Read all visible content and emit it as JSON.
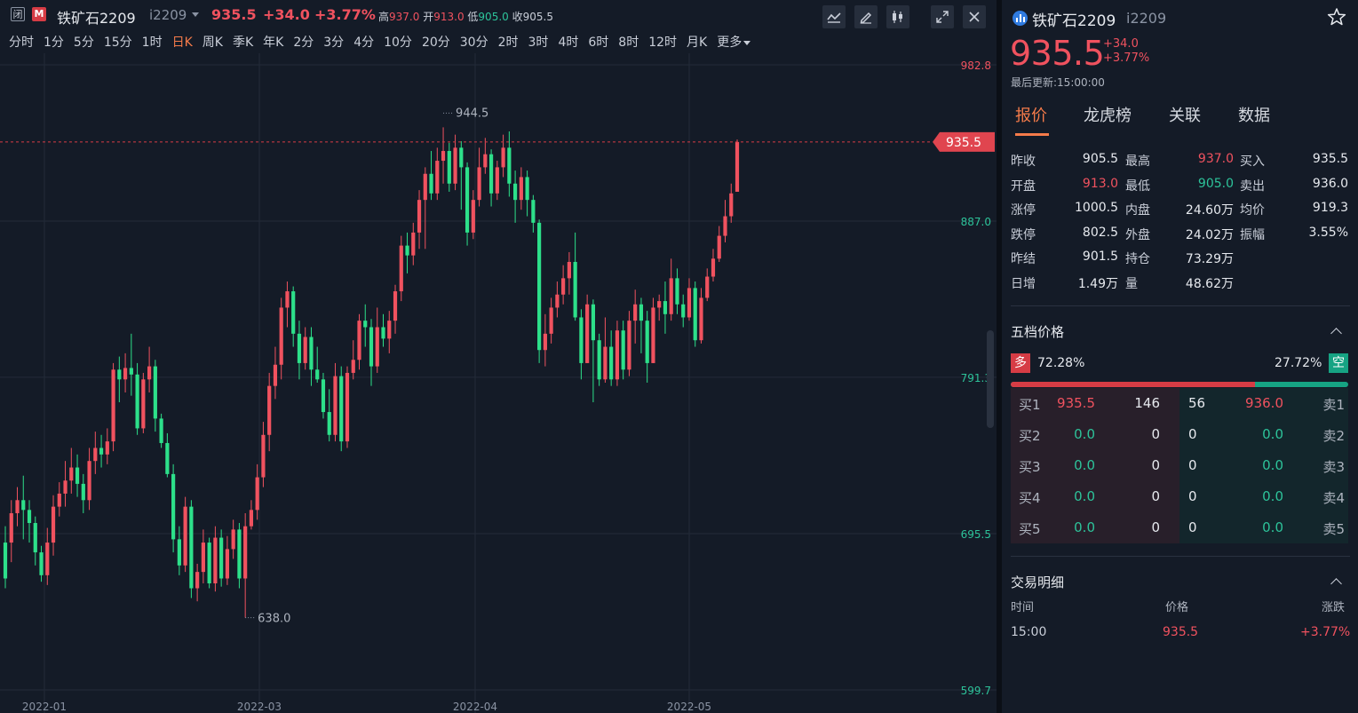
{
  "topbar": {
    "close_tag": "闭",
    "m_tag": "M",
    "symbol_name": "铁矿石2209",
    "symbol_code": "i2209",
    "price": "935.5",
    "change": "+34.0",
    "change_pct": "+3.77%",
    "high_label": "高",
    "high": "937.0",
    "open_label": "开",
    "open": "913.0",
    "low_label": "低",
    "low": "905.0",
    "close_label": "收",
    "close": "905.5"
  },
  "periods": [
    "分时",
    "1分",
    "5分",
    "15分",
    "1时",
    "日K",
    "周K",
    "季K",
    "年K",
    "2分",
    "3分",
    "4分",
    "10分",
    "20分",
    "30分",
    "2时",
    "3时",
    "4时",
    "6时",
    "8时",
    "12时",
    "月K",
    "更多"
  ],
  "active_period": "日K",
  "chart_data": {
    "type": "candlestick",
    "y_ticks": [
      "982.8",
      "887.0",
      "791.3",
      "695.5",
      "599.7"
    ],
    "y_range": [
      599.7,
      982.8
    ],
    "x_ticks": [
      "2022-01",
      "2022-03",
      "2022-04",
      "2022-05"
    ],
    "current_price_tag": "935.5",
    "max_label": "944.5",
    "min_label": "638.0",
    "colors": {
      "up": "#f0525f",
      "down": "#2de08a",
      "grid": "#232b38",
      "bg": "#141b27"
    },
    "candles": [
      [
        690.0,
        668.0,
        700.0,
        662.0
      ],
      [
        690.0,
        708.0,
        716.0,
        678.0
      ],
      [
        708.0,
        716.0,
        724.0,
        700.0
      ],
      [
        716.0,
        710.0,
        731.0,
        692.0
      ],
      [
        710.0,
        702.0,
        716.0,
        690.0
      ],
      [
        702.0,
        684.0,
        706.0,
        676.0
      ],
      [
        684.0,
        670.0,
        688.0,
        666.0
      ],
      [
        670.0,
        690.0,
        699.0,
        664.0
      ],
      [
        690.0,
        712.0,
        719.0,
        682.0
      ],
      [
        712.0,
        720.0,
        727.0,
        706.0
      ],
      [
        720.0,
        728.0,
        740.0,
        712.0
      ],
      [
        728.0,
        736.0,
        748.0,
        720.0
      ],
      [
        736.0,
        726.0,
        744.0,
        718.0
      ],
      [
        726.0,
        716.0,
        732.0,
        708.0
      ],
      [
        716.0,
        740.0,
        748.0,
        710.0
      ],
      [
        740.0,
        748.0,
        758.0,
        732.0
      ],
      [
        748.0,
        744.0,
        756.0,
        736.0
      ],
      [
        744.0,
        752.0,
        760.0,
        738.0
      ],
      [
        752.0,
        796.0,
        800.0,
        746.0
      ],
      [
        796.0,
        790.0,
        804.0,
        776.0
      ],
      [
        790.0,
        797.0,
        806.0,
        782.0
      ],
      [
        797.0,
        793.0,
        818.0,
        780.0
      ],
      [
        793.0,
        760.0,
        800.0,
        756.0
      ],
      [
        760.0,
        790.0,
        794.0,
        757.0
      ],
      [
        790.0,
        798.0,
        810.0,
        782.0
      ],
      [
        798.0,
        766.0,
        802.0,
        758.0
      ],
      [
        766.0,
        751.0,
        769.0,
        748.0
      ],
      [
        751.0,
        732.0,
        757.0,
        730.0
      ],
      [
        732.0,
        692.0,
        738.0,
        684.0
      ],
      [
        692.0,
        676.0,
        700.0,
        670.0
      ],
      [
        676.0,
        712.0,
        718.0,
        672.0
      ],
      [
        712.0,
        662.0,
        716.0,
        656.0
      ],
      [
        662.0,
        672.0,
        677.0,
        654.0
      ],
      [
        672.0,
        690.0,
        698.0,
        665.0
      ],
      [
        690.0,
        665.0,
        693.0,
        662.0
      ],
      [
        665.0,
        693.0,
        700.0,
        660.0
      ],
      [
        693.0,
        668.0,
        698.0,
        663.0
      ],
      [
        668.0,
        686.0,
        694.0,
        664.0
      ],
      [
        686.0,
        698.0,
        704.0,
        680.0
      ],
      [
        698.0,
        668.0,
        702.0,
        662.0
      ],
      [
        668.0,
        700.0,
        708.0,
        644.0
      ],
      [
        700.0,
        710.0,
        716.0,
        698.0
      ],
      [
        710.0,
        730.0,
        738.0,
        704.0
      ],
      [
        730.0,
        756.0,
        764.0,
        724.0
      ],
      [
        756.0,
        786.0,
        794.0,
        746.0
      ],
      [
        786.0,
        799.0,
        810.0,
        778.0
      ],
      [
        799.0,
        834.0,
        840.0,
        790.0
      ],
      [
        834.0,
        844.0,
        850.0,
        822.0
      ],
      [
        844.0,
        818.0,
        847.0,
        810.0
      ],
      [
        818.0,
        800.0,
        826.0,
        790.0
      ],
      [
        800.0,
        816.0,
        822.0,
        796.0
      ],
      [
        816.0,
        796.0,
        822.0,
        786.0
      ],
      [
        796.0,
        790.0,
        810.0,
        788.0
      ],
      [
        790.0,
        770.0,
        794.0,
        766.0
      ],
      [
        770.0,
        756.0,
        784.0,
        752.0
      ],
      [
        756.0,
        792.0,
        800.0,
        752.0
      ],
      [
        792.0,
        752.0,
        798.0,
        746.0
      ],
      [
        752.0,
        794.0,
        798.0,
        748.0
      ],
      [
        794.0,
        802.0,
        814.0,
        790.0
      ],
      [
        802.0,
        826.0,
        830.0,
        796.0
      ],
      [
        826.0,
        822.0,
        836.0,
        810.0
      ],
      [
        822.0,
        798.0,
        827.0,
        786.0
      ],
      [
        798.0,
        822.0,
        834.0,
        794.0
      ],
      [
        822.0,
        815.0,
        830.0,
        810.0
      ],
      [
        815.0,
        826.0,
        832.0,
        806.0
      ],
      [
        826.0,
        844.0,
        848.0,
        818.0
      ],
      [
        844.0,
        872.0,
        878.0,
        838.0
      ],
      [
        872.0,
        866.0,
        880.0,
        855.0
      ],
      [
        866.0,
        880.0,
        886.0,
        860.0
      ],
      [
        880.0,
        900.0,
        906.0,
        870.0
      ],
      [
        900.0,
        916.0,
        920.0,
        870.0
      ],
      [
        916.0,
        904.0,
        930.0,
        900.0
      ],
      [
        904.0,
        924.0,
        932.0,
        900.0
      ],
      [
        924.0,
        930.0,
        944.5,
        910.0
      ],
      [
        930.0,
        910.0,
        935.0,
        905.0
      ],
      [
        910.0,
        932.0,
        940.0,
        906.0
      ],
      [
        932.0,
        920.0,
        936.0,
        894.0
      ],
      [
        920.0,
        880.0,
        923.0,
        872.0
      ],
      [
        880.0,
        900.0,
        906.0,
        876.0
      ],
      [
        900.0,
        920.0,
        932.0,
        896.0
      ],
      [
        920.0,
        928.0,
        938.0,
        916.0
      ],
      [
        928.0,
        904.0,
        931.0,
        896.0
      ],
      [
        904.0,
        920.0,
        924.0,
        900.0
      ],
      [
        920.0,
        932.0,
        940.0,
        914.0
      ],
      [
        932.0,
        910.0,
        942.0,
        902.0
      ],
      [
        910.0,
        900.0,
        918.0,
        886.0
      ],
      [
        900.0,
        914.0,
        920.0,
        894.0
      ],
      [
        914.0,
        900.0,
        918.0,
        890.0
      ],
      [
        900.0,
        886.0,
        903.0,
        880.0
      ],
      [
        886.0,
        808.0,
        888.0,
        800.0
      ],
      [
        808.0,
        818.0,
        830.0,
        798.0
      ],
      [
        818.0,
        834.0,
        840.0,
        812.0
      ],
      [
        834.0,
        842.0,
        850.0,
        828.0
      ],
      [
        842.0,
        852.0,
        860.0,
        836.0
      ],
      [
        852.0,
        862.0,
        868.0,
        842.0
      ],
      [
        862.0,
        828.0,
        880.0,
        826.0
      ],
      [
        828.0,
        800.0,
        833.0,
        790.0
      ],
      [
        800.0,
        836.0,
        842.0,
        800.0
      ],
      [
        836.0,
        814.0,
        839.0,
        776.0
      ],
      [
        814.0,
        790.0,
        818.0,
        786.0
      ],
      [
        790.0,
        810.0,
        828.0,
        788.0
      ],
      [
        810.0,
        790.0,
        820.0,
        786.0
      ],
      [
        790.0,
        820.0,
        826.0,
        786.0
      ],
      [
        820.0,
        796.0,
        826.0,
        790.0
      ],
      [
        796.0,
        826.0,
        832.0,
        792.0
      ],
      [
        826.0,
        836.0,
        845.0,
        812.0
      ],
      [
        836.0,
        826.0,
        840.0,
        806.0
      ],
      [
        826.0,
        800.0,
        832.0,
        788.0
      ],
      [
        800.0,
        834.0,
        840.0,
        800.0
      ],
      [
        834.0,
        838.0,
        842.0,
        826.0
      ],
      [
        838.0,
        830.0,
        850.0,
        818.0
      ],
      [
        830.0,
        852.0,
        864.0,
        826.0
      ],
      [
        852.0,
        836.0,
        858.0,
        830.0
      ],
      [
        836.0,
        828.0,
        842.0,
        822.0
      ],
      [
        828.0,
        846.0,
        852.0,
        826.0
      ],
      [
        846.0,
        814.0,
        850.0,
        810.0
      ],
      [
        814.0,
        840.0,
        846.0,
        812.0
      ],
      [
        840.0,
        853.0,
        858.0,
        838.0
      ],
      [
        853.0,
        864.0,
        870.0,
        850.0
      ],
      [
        864.0,
        878.0,
        884.0,
        862.0
      ],
      [
        878.0,
        890.0,
        900.0,
        874.0
      ],
      [
        890.0,
        904.0,
        910.0,
        886.0
      ],
      [
        905.0,
        935.5,
        937.0,
        905.0
      ]
    ]
  },
  "quote": {
    "symbol_name": "铁矿石2209",
    "symbol_code": "i2209",
    "price": "935.5",
    "change": "+34.0",
    "change_pct": "+3.77%",
    "updated": "最后更新:15:00:00",
    "tabs": [
      "报价",
      "龙虎榜",
      "关联",
      "数据"
    ],
    "stats": [
      [
        {
          "l": "昨收",
          "v": "905.5",
          "c": "white"
        },
        {
          "l": "最高",
          "v": "937.0",
          "c": "red"
        },
        {
          "l": "买入",
          "v": "935.5",
          "c": "white"
        }
      ],
      [
        {
          "l": "开盘",
          "v": "913.0",
          "c": "red"
        },
        {
          "l": "最低",
          "v": "905.0",
          "c": "green"
        },
        {
          "l": "卖出",
          "v": "936.0",
          "c": "white"
        }
      ],
      [
        {
          "l": "涨停",
          "v": "1000.5",
          "c": "white"
        },
        {
          "l": "内盘",
          "v": "24.60万",
          "c": "white"
        },
        {
          "l": "均价",
          "v": "919.3",
          "c": "white"
        }
      ],
      [
        {
          "l": "跌停",
          "v": "802.5",
          "c": "white"
        },
        {
          "l": "外盘",
          "v": "24.02万",
          "c": "white"
        },
        {
          "l": "振幅",
          "v": "3.55%",
          "c": "white"
        }
      ],
      [
        {
          "l": "昨结",
          "v": "901.5",
          "c": "white"
        },
        {
          "l": "持仓",
          "v": "73.29万",
          "c": "white"
        }
      ],
      [
        {
          "l": "日增",
          "v": "1.49万",
          "c": "white"
        },
        {
          "l": "量",
          "v": "48.62万",
          "c": "white"
        }
      ]
    ]
  },
  "orderbook": {
    "title": "五档价格",
    "bid_tag": "多",
    "ask_tag": "空",
    "bid_ratio": "72.28%",
    "ask_ratio": "27.72%",
    "bid_fraction": 0.7228,
    "rows": [
      {
        "bl": "买1",
        "bp": "935.5",
        "bv": "146",
        "av": "56",
        "ap": "936.0",
        "al": "卖1"
      },
      {
        "bl": "买2",
        "bp": "0.0",
        "bv": "0",
        "av": "0",
        "ap": "0.0",
        "al": "卖2"
      },
      {
        "bl": "买3",
        "bp": "0.0",
        "bv": "0",
        "av": "0",
        "ap": "0.0",
        "al": "卖3"
      },
      {
        "bl": "买4",
        "bp": "0.0",
        "bv": "0",
        "av": "0",
        "ap": "0.0",
        "al": "卖4"
      },
      {
        "bl": "买5",
        "bp": "0.0",
        "bv": "0",
        "av": "0",
        "ap": "0.0",
        "al": "卖5"
      }
    ]
  },
  "trades": {
    "title": "交易明细",
    "headers": [
      "时间",
      "价格",
      "涨跌"
    ],
    "rows": [
      {
        "time": "15:00",
        "price": "935.5",
        "change": "+3.77%"
      }
    ]
  }
}
